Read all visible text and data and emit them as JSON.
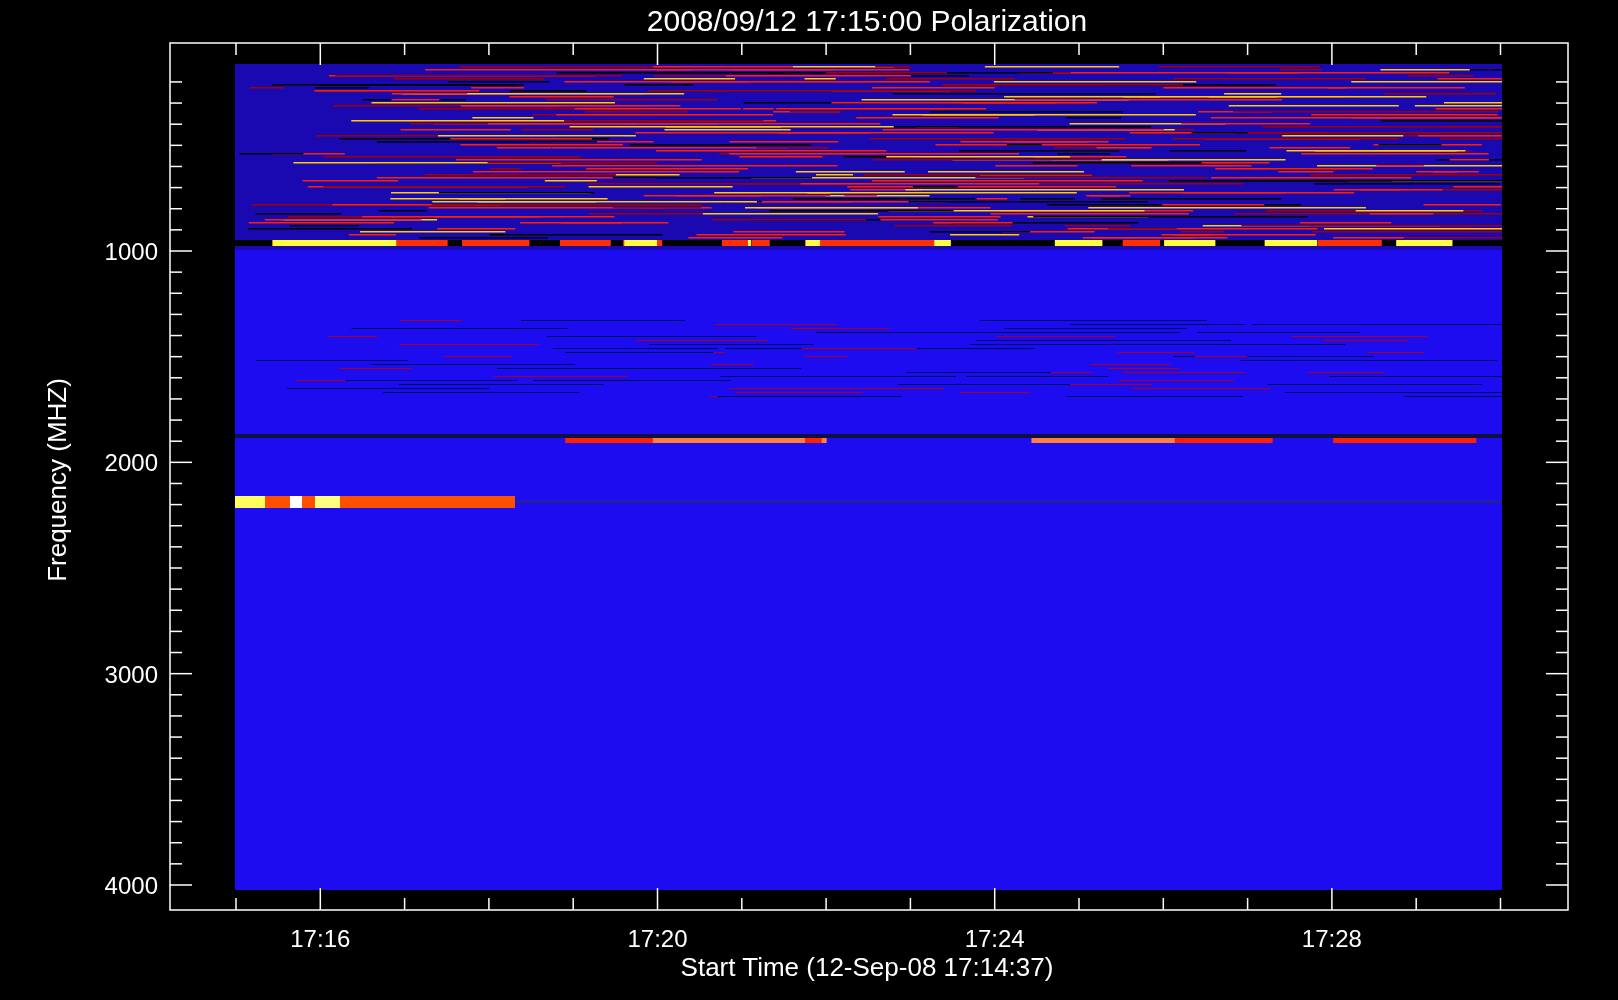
{
  "title": "2008/09/12 17:15:00 Polarization",
  "y_axis": {
    "label": "Frequency (MHZ)",
    "ticks": [
      "1000",
      "2000",
      "3000",
      "4000"
    ]
  },
  "x_axis": {
    "label": "Start Time (12-Sep-08 17:14:37)",
    "ticks": [
      "17:16",
      "17:20",
      "17:24",
      "17:28"
    ]
  }
}
